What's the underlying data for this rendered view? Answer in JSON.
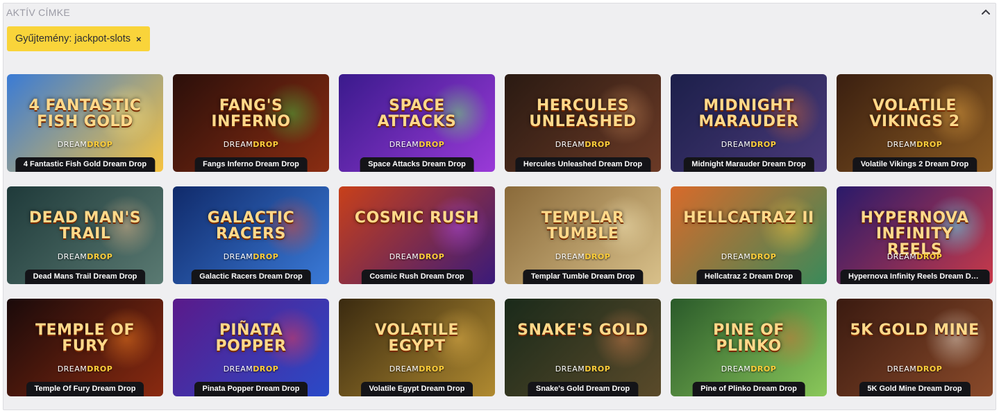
{
  "section": {
    "title": "AKTÍV CÍMKE"
  },
  "filter_chip": {
    "label": "Gyűjtemény: jackpot-slots",
    "remove_icon": "×"
  },
  "games": [
    {
      "name": "4 Fantastic Fish Gold Dream Drop",
      "art_title": "4 FANTASTIC FISH GOLD",
      "art_sub": "DREAM",
      "art_sub_bold": "DROP",
      "bg": [
        "#3a7bd5",
        "#f6c340"
      ],
      "glow": "#ffe27a"
    },
    {
      "name": "Fangs Inferno Dream Drop",
      "art_title": "FANG'S INFERNO",
      "art_sub": "DREAM",
      "art_sub_bold": "DROP",
      "bg": [
        "#2b0f0a",
        "#8a2d12"
      ],
      "glow": "#4fb33c"
    },
    {
      "name": "Space Attacks Dream Drop",
      "art_title": "SPACE ATTACKS",
      "art_sub": "DREAM",
      "art_sub_bold": "DROP",
      "bg": [
        "#3a1a8c",
        "#9a3ad8"
      ],
      "glow": "#6fe070"
    },
    {
      "name": "Hercules Unleashed Dream Drop",
      "art_title": "HERCULES UNLEASHED",
      "art_sub": "DREAM",
      "art_sub_bold": "DROP",
      "bg": [
        "#2a1a12",
        "#6b3a26"
      ],
      "glow": "#c98a5a"
    },
    {
      "name": "Midnight Marauder Dream Drop",
      "art_title": "MIDNIGHT MARAUDER",
      "art_sub": "DREAM",
      "art_sub_bold": "DROP",
      "bg": [
        "#1c1f4a",
        "#4a3a7a"
      ],
      "glow": "#c9623a"
    },
    {
      "name": "Volatile Vikings 2 Dream Drop",
      "art_title": "VOLATILE VIKINGS 2",
      "art_sub": "DREAM",
      "art_sub_bold": "DROP",
      "bg": [
        "#3a1f10",
        "#8a5a22"
      ],
      "glow": "#e0a040"
    },
    {
      "name": "Dead Mans Trail Dream Drop",
      "art_title": "DEAD MAN'S TRAIL",
      "art_sub": "DREAM",
      "art_sub_bold": "DROP",
      "bg": [
        "#1f3a3a",
        "#5a7a72"
      ],
      "glow": "#d8b48a"
    },
    {
      "name": "Galactic Racers Dream Drop",
      "art_title": "GALACTIC RACERS",
      "art_sub": "DREAM",
      "art_sub_bold": "DROP",
      "bg": [
        "#102a6a",
        "#3a7ad8"
      ],
      "glow": "#d84a3a"
    },
    {
      "name": "Cosmic Rush Dream Drop",
      "art_title": "COSMIC RUSH",
      "art_sub": "DREAM",
      "art_sub_bold": "DROP",
      "bg": [
        "#c8401a",
        "#3a1a7a"
      ],
      "glow": "#b04ae0"
    },
    {
      "name": "Templar Tumble Dream Drop",
      "art_title": "TEMPLAR TUMBLE",
      "art_sub": "DREAM",
      "art_sub_bold": "DROP",
      "bg": [
        "#8a6a3a",
        "#d8c08a"
      ],
      "glow": "#f0e0b0"
    },
    {
      "name": "Hellcatraz 2 Dream Drop",
      "art_title": "HELLCATRAZ II",
      "art_sub": "DREAM",
      "art_sub_bold": "DROP",
      "bg": [
        "#d86a2a",
        "#3a8a5a"
      ],
      "glow": "#f0c040"
    },
    {
      "name": "Hypernova Infinity Reels Dream Drop",
      "art_title": "HYPERNOVA INFINITY REELS",
      "art_sub": "DREAM",
      "art_sub_bold": "DROP",
      "bg": [
        "#2a1a6a",
        "#c83a4a"
      ],
      "glow": "#6ae0f0"
    },
    {
      "name": "Temple Of Fury Dream Drop",
      "art_title": "TEMPLE OF FURY",
      "art_sub": "DREAM",
      "art_sub_bold": "DROP",
      "bg": [
        "#1a0a0a",
        "#8a2a10"
      ],
      "glow": "#f07a20"
    },
    {
      "name": "Pinata Popper Dream Drop",
      "art_title": "PIÑATA POPPER",
      "art_sub": "DREAM",
      "art_sub_bold": "DROP",
      "bg": [
        "#5a1a8a",
        "#2a4ac8"
      ],
      "glow": "#e03a5a"
    },
    {
      "name": "Volatile Egypt Dream Drop",
      "art_title": "VOLATILE EGYPT",
      "art_sub": "DREAM",
      "art_sub_bold": "DROP",
      "bg": [
        "#3a2a10",
        "#b08a30"
      ],
      "glow": "#e0b04a"
    },
    {
      "name": "Snake's Gold Dream Drop",
      "art_title": "SNAKE'S GOLD",
      "art_sub": "DREAM",
      "art_sub_bold": "DROP",
      "bg": [
        "#1a2a1a",
        "#5a4a2a"
      ],
      "glow": "#c87a4a"
    },
    {
      "name": "Pine of Plinko Dream Drop",
      "art_title": "PINE OF PLINKO",
      "art_sub": "DREAM",
      "art_sub_bold": "DROP",
      "bg": [
        "#2a5a2a",
        "#8ac85a"
      ],
      "glow": "#c87a3a"
    },
    {
      "name": "5K Gold Mine Dream Drop",
      "art_title": "5K GOLD MINE",
      "art_sub": "DREAM",
      "art_sub_bold": "DROP",
      "bg": [
        "#3a1a10",
        "#8a4a2a"
      ],
      "glow": "#e0d0c0"
    }
  ]
}
